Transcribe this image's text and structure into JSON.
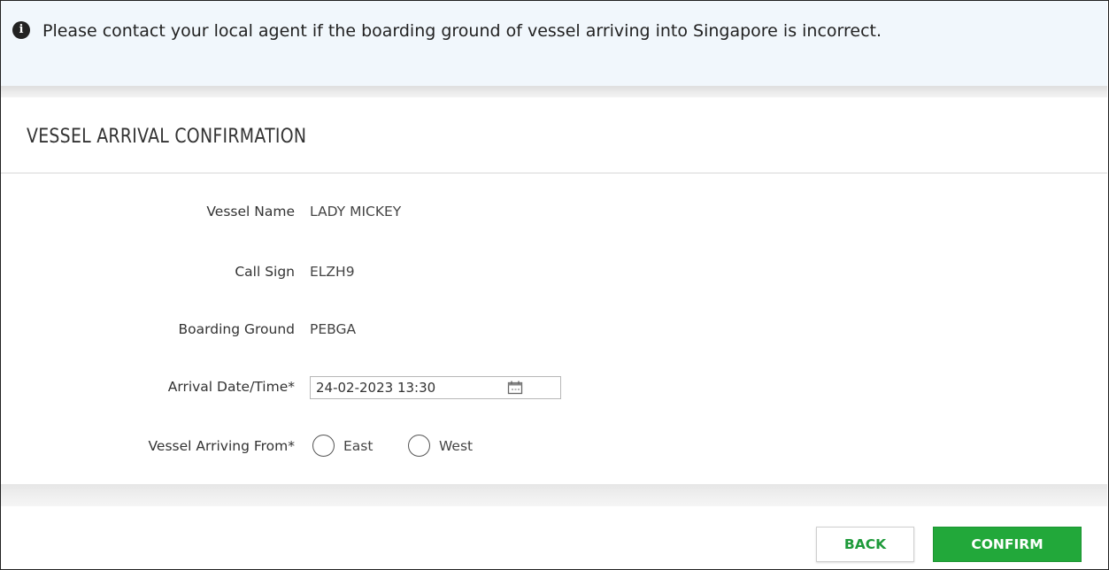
{
  "notice": {
    "icon": "info-icon",
    "text": "Please contact your local agent if the boarding ground of vessel arriving into Singapore is incorrect."
  },
  "panel": {
    "title": "VESSEL ARRIVAL CONFIRMATION"
  },
  "fields": {
    "vessel_name": {
      "label": "Vessel Name",
      "value": "LADY MICKEY"
    },
    "call_sign": {
      "label": "Call Sign",
      "value": "ELZH9"
    },
    "boarding_ground": {
      "label": "Boarding Ground",
      "value": "PEBGA"
    },
    "arrival": {
      "label": "Arrival Date/Time*",
      "value": "24-02-2023 13:30",
      "icon": "calendar-icon"
    },
    "arriving_from": {
      "label": "Vessel Arriving From*",
      "options": [
        "East",
        "West"
      ],
      "selected": ""
    }
  },
  "actions": {
    "back_label": "BACK",
    "confirm_label": "CONFIRM"
  },
  "colors": {
    "accent": "#22a83a",
    "notice_bg": "#f1f7fc"
  }
}
